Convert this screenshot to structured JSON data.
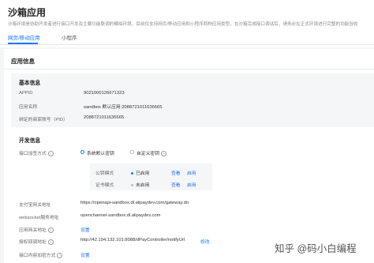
{
  "page": {
    "title": "沙箱应用",
    "description": "沙箱环境是协助开发者进行接口开发及主要功能联调的模拟环境，目前仅支持网页/移动应用和小程序两种应用类型。在沙箱完成接口调试后，请务必在正式环境进行完整的功能验收"
  },
  "tabs": [
    {
      "label": "网页/移动应用"
    },
    {
      "label": "小程序"
    }
  ],
  "app_info": {
    "title": "应用信息",
    "basic": {
      "title": "基本信息",
      "rows": [
        {
          "label": "APPID",
          "value": "9021000126671323"
        },
        {
          "label": "应用名称",
          "value": "sandbox 默认应用:2088721011636665"
        },
        {
          "label": "绑定的商家账号（PID）",
          "value": "2088721011636665"
        }
      ]
    },
    "dev": {
      "title": "开发信息",
      "sign_method": {
        "label": "接口加签方式",
        "options": [
          "系统默认密钥",
          "自定义密钥"
        ],
        "selected": "系统默认密钥"
      },
      "key_modes": [
        {
          "name": "公钥模式",
          "status": "已启用",
          "status_color": "#1677ff",
          "actions": [
            "查看",
            "启用"
          ]
        },
        {
          "name": "证书模式",
          "status": "未启用",
          "status_color": "#bbbbbb",
          "actions": [
            "查看",
            "启用"
          ]
        }
      ],
      "gateway": {
        "label": "支付宝网关地址",
        "value": "https://openapi-sandbox.dl.alipaydev.com/gateway.do"
      },
      "websocket": {
        "label": "websocket服务地址",
        "value": "openchannel-sandbox.dl.alipaydev.com"
      },
      "app_gateway": {
        "label": "应用网关地址",
        "action": "设置"
      },
      "callback": {
        "label": "授权回调地址",
        "value": "http://42.194.132.101:8088/dPayController/notifyUrl",
        "action": "修改"
      },
      "content_encrypt": {
        "label": "接口内容加密方式",
        "action": "设置"
      }
    }
  },
  "watermark": {
    "text": "知乎 @码小白编程"
  },
  "colors": {
    "accent": "#1677ff",
    "page_bg": "#f4f5f7",
    "box_bg": "#f5f6f8"
  }
}
